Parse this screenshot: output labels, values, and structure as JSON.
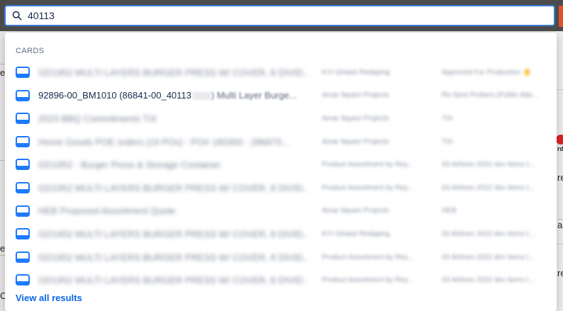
{
  "search": {
    "value": "40113",
    "icon": "search-icon"
  },
  "dropdown": {
    "section_title": "CARDS",
    "view_all_label": "View all results",
    "accent_color": "#0c66e4",
    "card_icon_color": "#1d7afc",
    "results": [
      {
        "title": "GD1952 MULTI LAYERS BURGER PRESS W/ COVER, 8 DIVID...",
        "board": "KYI Ghiasti Redaping",
        "list": "Approved For Production 🤚",
        "blurred": true
      },
      {
        "title_prefix": "92896-00_BM1010 (86841-00_40113",
        "title_suffix": ") Multi Layer Burge...",
        "board": "Amar Ilayani Projects",
        "list": "Re-Sent Probers (Public Atte...",
        "blurred": false
      },
      {
        "title": "2023 BBQ Commitments TIX",
        "board": "Amar Ilayani Projects",
        "list": "TIX",
        "blurred": true
      },
      {
        "title": "Home Goods POE orders (19 POs) - PO# 180300 - 286975...",
        "board": "Amar Ilayani Projects",
        "list": "TIX",
        "blurred": true
      },
      {
        "title": "GD1952 - Burger Press & Storage Container",
        "board": "Product Assortment by Rey...",
        "list": "03 Airlines 2022 dev items t...",
        "blurred": true
      },
      {
        "title": "GD1952 MULTI LAYERS BURGER PRESS W/ COVER, 8 DIVID...",
        "board": "Product Assortment by Rey...",
        "list": "03 Airlines 2022 dev items t...",
        "blurred": true
      },
      {
        "title": "HEB Proposed Assortment Quote",
        "board": "Amar Ilayani Projects",
        "list": "HEB",
        "blurred": true
      },
      {
        "title": "GD1952 MULTI LAYERS BURGER PRESS W/ COVER, 8 DIVID...",
        "board": "KYI Ghiasti Redaping",
        "list": "03 Airlines 2022 dev items t...",
        "blurred": true
      },
      {
        "title": "GD1952 MULTI LAYERS BURGER PRESS W/ COVER, 8 DIVID...",
        "board": "Product Assortment by Rey...",
        "list": "03 Airlines 2022 dev items t...",
        "blurred": true
      },
      {
        "title": "GD1952 MULTI LAYERS BURGER PRESS W/ COVER, 8 DIVID...",
        "board": "Product Assortment by Rey...",
        "list": "03 Airlines 2022 dev items t...",
        "blurred": true
      }
    ]
  },
  "background": {
    "fragments": [
      "e",
      "rd",
      "re",
      "ar",
      "ea",
      "re",
      "C"
    ]
  }
}
